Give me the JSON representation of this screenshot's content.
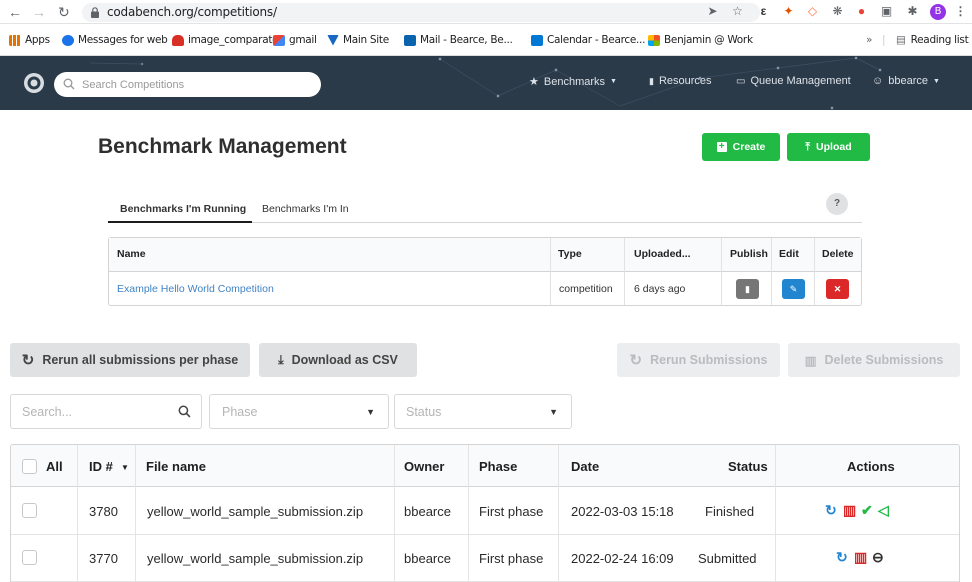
{
  "browser": {
    "url": "codabench.org/competitions/",
    "bookmarks": [
      {
        "label": "Apps",
        "icon": "apps-grid-icon",
        "color": "#e37400"
      },
      {
        "label": "Messages for web",
        "icon": "messages-icon",
        "color": "#1a73e8"
      },
      {
        "label": "image_comparator",
        "icon": "car-icon",
        "color": "#d93025"
      },
      {
        "label": "gmail",
        "icon": "gmail-icon",
        "color": "#ea4335"
      },
      {
        "label": "Main Site",
        "icon": "vuetify-icon",
        "color": "#1867c0"
      },
      {
        "label": "Mail - Bearce, Be...",
        "icon": "outlook-icon",
        "color": "#0a64ad"
      },
      {
        "label": "Calendar - Bearce...",
        "icon": "calendar-icon",
        "color": "#0078d4"
      },
      {
        "label": "Benjamin @ Work",
        "icon": "workspace-icon",
        "color": "#f25022"
      }
    ],
    "overflow_label": "»",
    "reading_list_label": "Reading list",
    "profile_initial": "B"
  },
  "navbar": {
    "search_placeholder": "Search Competitions",
    "items": [
      {
        "label": "Benchmarks",
        "icon": "trophy-icon",
        "has_caret": true
      },
      {
        "label": "Resources",
        "icon": "file-icon",
        "has_caret": false
      },
      {
        "label": "Queue Management",
        "icon": "monitor-icon",
        "has_caret": false
      },
      {
        "label": "bbearce",
        "icon": "user-icon",
        "has_caret": true
      }
    ]
  },
  "benchmark": {
    "title": "Benchmark Management",
    "create_label": "Create",
    "upload_label": "Upload",
    "tabs": [
      "Benchmarks I'm Running",
      "Benchmarks I'm In"
    ],
    "help_label": "?",
    "columns": [
      "Name",
      "Type",
      "Uploaded...",
      "Publish",
      "Edit",
      "Delete"
    ],
    "rows": [
      {
        "name": "Example Hello World Competition",
        "type": "competition",
        "uploaded": "6 days ago"
      }
    ]
  },
  "submissions": {
    "rerun_all_label": "Rerun all submissions per phase",
    "download_csv_label": "Download as CSV",
    "rerun_label": "Rerun Submissions",
    "delete_label": "Delete Submissions",
    "search_placeholder": "Search...",
    "phase_placeholder": "Phase",
    "status_placeholder": "Status",
    "columns": [
      "All",
      "ID #",
      "File name",
      "Owner",
      "Phase",
      "Date",
      "Status",
      "Actions"
    ],
    "rows": [
      {
        "id": "3780",
        "file": "yellow_world_sample_submission.zip",
        "owner": "bbearce",
        "phase": "First phase",
        "date": "2022-03-03 15:18",
        "status": "Finished",
        "actions": [
          "rerun-icon",
          "trash-icon",
          "check-icon",
          "share-icon"
        ]
      },
      {
        "id": "3770",
        "file": "yellow_world_sample_submission.zip",
        "owner": "bbearce",
        "phase": "First phase",
        "date": "2022-02-24 16:09",
        "status": "Submitted",
        "actions": [
          "rerun-icon",
          "trash-icon",
          "cancel-icon"
        ]
      }
    ]
  },
  "colors": {
    "navbar": "#2b3a48",
    "green": "#21ba45",
    "blue_link": "#4183c4",
    "edit_blue": "#2185d0",
    "delete_red": "#db2828",
    "action_teal": "#00b5ad"
  }
}
